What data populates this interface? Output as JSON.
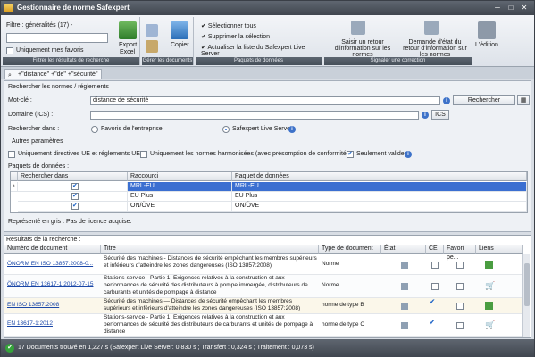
{
  "window": {
    "title": "Gestionnaire de norme Safexpert"
  },
  "ribbon": {
    "filter_label": "Filtre : généralités (17) -",
    "fav_only": "Uniquement mes favoris",
    "export_label": "Export",
    "excel_label": "Excel",
    "copy_label": "Copier",
    "group_filter": "Filtrer les résultats de recherche",
    "group_docs": "Gérer les documents",
    "group_packages": "Paquets de données",
    "group_manage": "Signaler une correction",
    "select_all": "Sélectionner tous",
    "delete_selection": "Supprimer la sélection",
    "update_list": "Actualiser la liste du Safexpert Live Server",
    "report_return": "Saisir un retour d'information sur les normes",
    "request_state": "Demande d'état du retour d'information sur les normes",
    "edition": "L'édition"
  },
  "tab": {
    "label": "+\"distance\" +\"de\" +\"sécurité\""
  },
  "search": {
    "header": "Rechercher les normes / réglements",
    "keyword_label": "Mot-clé :",
    "keyword_value": "distance de sécurité",
    "search_button": "Rechercher",
    "domain_label": "Domaine (ICS) :",
    "ics_button": "ICS",
    "search_in_label": "Rechercher dans :",
    "radio_fav": "Favoris de l'entreprise",
    "radio_live": "Safexpert Live Server",
    "other_params": "Autres paramètres",
    "opt_ue": "Uniquement directives UE et réglements UE",
    "opt_harm": "Uniquement les normes harmonisées (avec présomption de conformité)",
    "opt_valid": "Seulement valides",
    "packages_label": "Paquets de données :",
    "grey_note": "Représenté en gris : Pas de licence acquise."
  },
  "packages_table": {
    "headers": [
      "Rechercher dans",
      "Raccourci",
      "Paquet de données"
    ],
    "rows": [
      {
        "short": "MRL-EU",
        "name": "MRL-EU",
        "checked": true
      },
      {
        "short": "EU Plus",
        "name": "EU Plus",
        "checked": true
      },
      {
        "short": "ON/ÖVE",
        "name": "ON/ÖVE",
        "checked": true
      }
    ]
  },
  "results": {
    "header": "Résultats de la recherche :",
    "columns": [
      "Numéro de document",
      "Titre",
      "Type de document",
      "État",
      "CE",
      "Favori pe...",
      "Liens"
    ],
    "rows": [
      {
        "doc": "ÖNORM EN ISO 13857:2008-0...",
        "title": "Sécurité des machines - Distances de sécurité empêchant les membres supérieurs et inférieurs d'atteindre les zones dangereuses (ISO 13857:2008)",
        "type": "Norme",
        "ce": false
      },
      {
        "doc": "ÖNORM EN 13617-1:2012-07-15",
        "title": "Stations-service - Partie 1: Exigences relatives à la construction et aux performances de sécurité des distributeurs à pompe immergée, distributeurs de carburants et unités de pompage à distance",
        "type": "Norme",
        "ce": false
      },
      {
        "doc": "EN ISO 13857:2008",
        "title": "Sécurité des machines — Distances de sécurité empêchant les membres supérieurs et inférieurs d'atteindre les zones dangereuses (ISO 13857:2008)",
        "type": "norme de type B",
        "ce": true
      },
      {
        "doc": "EN 13617-1:2012",
        "title": "Stations-service - Partie 1: Exigences relatives à la construction et aux performances de sécurité des distributeurs de carburants et unités de pompage à distance",
        "type": "norme de type C",
        "ce": true
      }
    ]
  },
  "status": {
    "text": "17 Documents trouvé en 1,227 s (Safexpert Live Server: 0,830 s ; Transfert : 0,324 s ; Traitement : 0,073 s)"
  }
}
